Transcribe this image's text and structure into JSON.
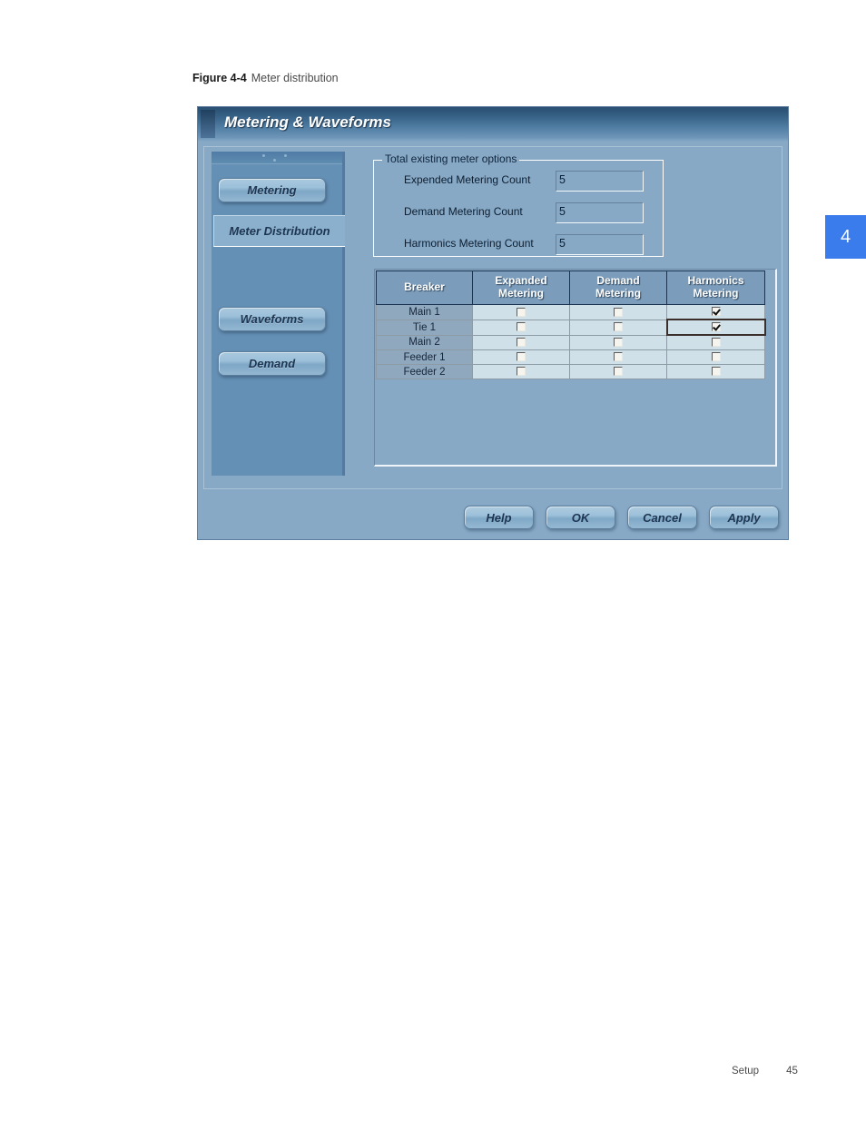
{
  "figure": {
    "number": "Figure 4-4",
    "caption": "Meter distribution"
  },
  "chapter_tab": {
    "number": "4",
    "color": "#3b7ced"
  },
  "footer": {
    "section": "Setup",
    "page": "45"
  },
  "dialog": {
    "title": "Metering & Waveforms",
    "sidebar": {
      "items": [
        {
          "label": "Metering",
          "active": false
        },
        {
          "label": "Meter Distribution",
          "active": true
        },
        {
          "label": "Waveforms",
          "active": false
        },
        {
          "label": "Demand",
          "active": false
        }
      ]
    },
    "group": {
      "legend": "Total existing meter options",
      "fields": [
        {
          "label": "Expended Metering Count",
          "value": "5"
        },
        {
          "label": "Demand Metering Count",
          "value": "5"
        },
        {
          "label": "Harmonics Metering Count",
          "value": "5"
        }
      ]
    },
    "table": {
      "headers": [
        {
          "line1": "Breaker",
          "line2": ""
        },
        {
          "line1": "Expanded",
          "line2": "Metering"
        },
        {
          "line1": "Demand",
          "line2": "Metering"
        },
        {
          "line1": "Harmonics",
          "line2": "Metering"
        }
      ],
      "rows": [
        {
          "breaker": "Main 1",
          "expanded": false,
          "demand": false,
          "harmonics": true,
          "focused": ""
        },
        {
          "breaker": "Tie 1",
          "expanded": false,
          "demand": false,
          "harmonics": true,
          "focused": "harmonics"
        },
        {
          "breaker": "Main 2",
          "expanded": false,
          "demand": false,
          "harmonics": false,
          "focused": ""
        },
        {
          "breaker": "Feeder 1",
          "expanded": false,
          "demand": false,
          "harmonics": false,
          "focused": ""
        },
        {
          "breaker": "Feeder 2",
          "expanded": false,
          "demand": false,
          "harmonics": false,
          "focused": ""
        }
      ]
    },
    "buttons": [
      {
        "label": "Help"
      },
      {
        "label": "OK"
      },
      {
        "label": "Cancel"
      },
      {
        "label": "Apply"
      }
    ]
  }
}
